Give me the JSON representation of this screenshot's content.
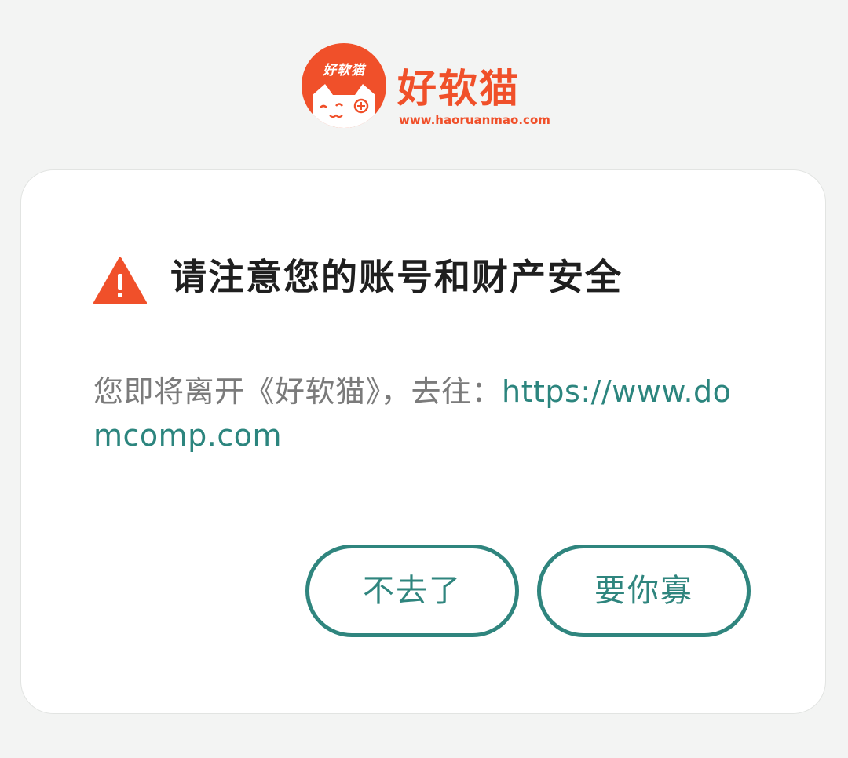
{
  "brand": {
    "badge_text": "好软猫",
    "name": "好软猫",
    "url": "www.haoruanmao.com",
    "color": "#f0502a"
  },
  "dialog": {
    "icon": "warning-triangle-icon",
    "title": "请注意您的账号和财产安全",
    "message_prefix": "您即将离开《好软猫》，去往：",
    "link": "https://www.domcomp.com",
    "cancel_label": "不去了",
    "confirm_label": "要你寡",
    "accent_color": "#2f857e",
    "warning_color": "#f0502a"
  }
}
